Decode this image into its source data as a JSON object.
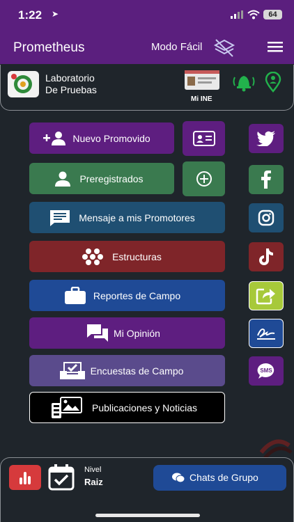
{
  "status": {
    "time": "1:22",
    "battery": "64"
  },
  "header": {
    "title": "Prometheus",
    "mode_label": "Modo Fácil"
  },
  "profile": {
    "org_line1": "Laboratorio",
    "org_line2": "De Pruebas",
    "ine_label": "Mi INE"
  },
  "menu": [
    {
      "label": "Nuevo Promovido",
      "color": "#5e1e80"
    },
    {
      "label": "Preregistrados",
      "color": "#3a7a4f"
    },
    {
      "label": "Mensaje a mis Promotores",
      "color": "#1f4f72"
    },
    {
      "label": "Estructuras",
      "color": "#7f2529"
    },
    {
      "label": "Reportes de Campo",
      "color": "#1f4a96"
    },
    {
      "label": "Mi Opinión",
      "color": "#5e1e80"
    },
    {
      "label": "Encuestas de Campo",
      "color": "#5a4b8c"
    },
    {
      "label": "Publicaciones y Noticias",
      "color": "#000000"
    }
  ],
  "social": [
    {
      "icon": "twitter-icon",
      "color": "#5e1e80"
    },
    {
      "icon": "facebook-icon",
      "color": "#3a7a4f"
    },
    {
      "icon": "instagram-icon",
      "color": "#1f4f72"
    },
    {
      "icon": "tiktok-icon",
      "color": "#7f2529"
    },
    {
      "icon": "share-icon",
      "color": "#a7c93a"
    },
    {
      "icon": "signature-icon",
      "color": "#1f4a96"
    },
    {
      "icon": "sms-icon",
      "color": "#5e1e80"
    }
  ],
  "bottom": {
    "nivel_label": "Nivel",
    "nivel_value": "Raiz",
    "chat_label": "Chats de Grupo"
  }
}
